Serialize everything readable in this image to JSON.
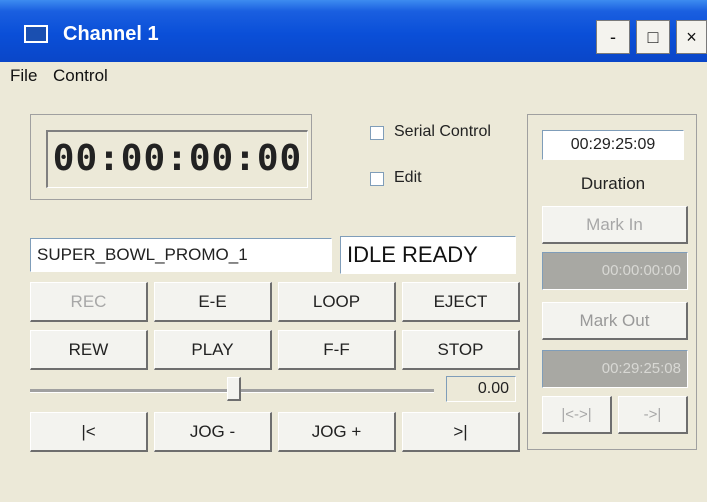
{
  "window": {
    "title": "Channel 1",
    "minimize": "-",
    "maximize": "□",
    "close": "×"
  },
  "menu": {
    "items": [
      "File",
      "Control"
    ]
  },
  "timecode": {
    "display": "00:00:00:00"
  },
  "options": {
    "serial_control": "Serial Control",
    "edit": "Edit"
  },
  "clip": {
    "name": "SUPER_BOWL_PROMO_1",
    "status": "IDLE READY"
  },
  "transport": {
    "rec": "REC",
    "ee": "E-E",
    "loop": "LOOP",
    "eject": "EJECT",
    "rew": "REW",
    "play": "PLAY",
    "ff": "F-F",
    "stop": "STOP",
    "jog_start": "|<",
    "jog_minus": "JOG -",
    "jog_plus": "JOG +",
    "jog_end": ">|"
  },
  "speed": {
    "value": "0.00"
  },
  "side": {
    "duration_value": "00:29:25:09",
    "duration_label": "Duration",
    "mark_in": "Mark In",
    "mark_in_value": "00:00:00:00",
    "mark_out": "Mark Out",
    "mark_out_value": "00:29:25:08",
    "goto_range": "|<->|",
    "goto_end": "->|"
  }
}
